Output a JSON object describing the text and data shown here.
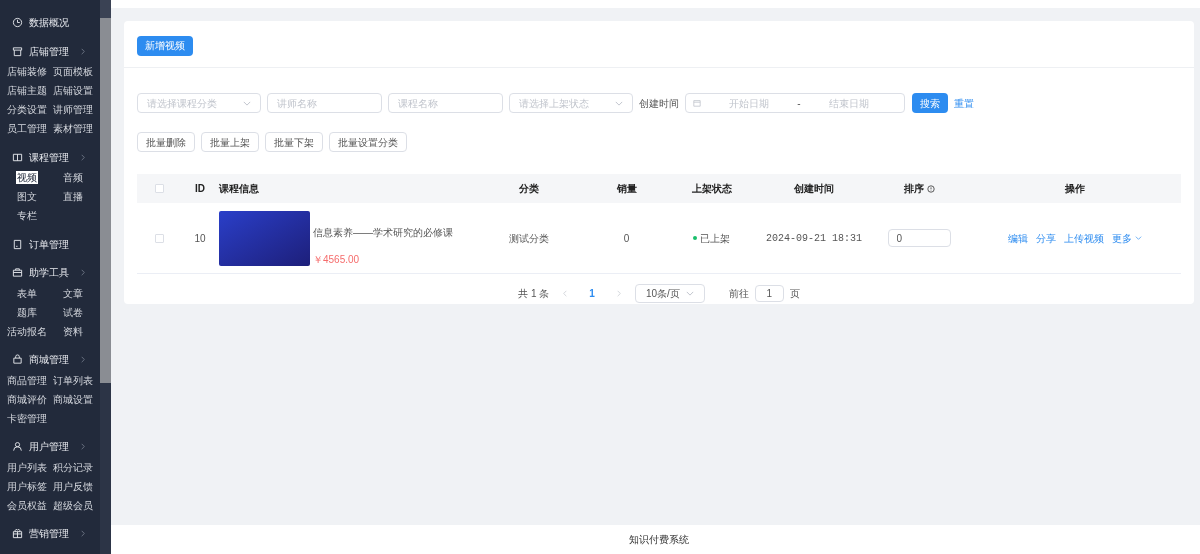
{
  "sidebar": {
    "groups": [
      {
        "title": "数据概况",
        "chevron": false
      },
      {
        "title": "店铺管理",
        "chevron": true,
        "items": [
          {
            "label": "店铺装修",
            "selected": false
          },
          {
            "label": "页面模板",
            "selected": false
          },
          {
            "label": "店铺主题",
            "selected": false
          },
          {
            "label": "店铺设置",
            "selected": false
          },
          {
            "label": "分类设置",
            "selected": false
          },
          {
            "label": "讲师管理",
            "selected": false
          },
          {
            "label": "员工管理",
            "selected": false
          },
          {
            "label": "素材管理",
            "selected": false
          }
        ]
      },
      {
        "title": "课程管理",
        "chevron": true,
        "items": [
          {
            "label": "视频",
            "selected": true
          },
          {
            "label": "音频",
            "selected": false
          },
          {
            "label": "图文",
            "selected": false
          },
          {
            "label": "直播",
            "selected": false
          },
          {
            "label": "专栏",
            "selected": false
          }
        ]
      },
      {
        "title": "订单管理",
        "chevron": false
      },
      {
        "title": "助学工具",
        "chevron": true,
        "items": [
          {
            "label": "表单",
            "selected": false
          },
          {
            "label": "文章",
            "selected": false
          },
          {
            "label": "题库",
            "selected": false
          },
          {
            "label": "试卷",
            "selected": false
          },
          {
            "label": "活动报名",
            "selected": false
          },
          {
            "label": "资料",
            "selected": false
          }
        ]
      },
      {
        "title": "商城管理",
        "chevron": true,
        "items": [
          {
            "label": "商品管理",
            "selected": false
          },
          {
            "label": "订单列表",
            "selected": false
          },
          {
            "label": "商城评价",
            "selected": false
          },
          {
            "label": "商城设置",
            "selected": false
          },
          {
            "label": "卡密管理",
            "selected": false
          }
        ]
      },
      {
        "title": "用户管理",
        "chevron": true,
        "items": [
          {
            "label": "用户列表",
            "selected": false
          },
          {
            "label": "积分记录",
            "selected": false
          },
          {
            "label": "用户标签",
            "selected": false
          },
          {
            "label": "用户反馈",
            "selected": false
          },
          {
            "label": "会员权益",
            "selected": false
          },
          {
            "label": "超级会员",
            "selected": false
          }
        ]
      },
      {
        "title": "营销管理",
        "chevron": true
      }
    ]
  },
  "add_button": "新增视频",
  "filters": {
    "category": {
      "placeholder": "请选择课程分类"
    },
    "teacher": {
      "placeholder": "讲师名称"
    },
    "course": {
      "placeholder": "课程名称"
    },
    "status": {
      "placeholder": "请选择上架状态"
    },
    "date_label": "创建时间",
    "start": {
      "placeholder": "开始日期"
    },
    "separator": "-",
    "end": {
      "placeholder": "结束日期"
    },
    "search": "搜索",
    "reset": "重置"
  },
  "batch_buttons": [
    "批量删除",
    "批量上架",
    "批量下架",
    "批量设置分类"
  ],
  "table": {
    "all_checked": false,
    "columns": [
      "ID",
      "课程信息",
      "分类",
      "销量",
      "上架状态",
      "创建时间",
      "排序",
      "操作"
    ],
    "rows": [
      {
        "checked": false,
        "id": "10",
        "title": "信息素养——学术研究的必修课",
        "price": "￥4565.00",
        "category": "测试分类",
        "sales": "0",
        "status": "已上架",
        "published": true,
        "created": "2024-09-21 18:31",
        "sort": "0",
        "actions": [
          "编辑",
          "分享",
          "上传视频",
          "更多"
        ]
      }
    ]
  },
  "pagination": {
    "total": "共 1 条",
    "pages": [
      {
        "label": "1",
        "selected": true
      }
    ],
    "page_size": "10条/页",
    "goto_label": "前往",
    "goto_value": "1",
    "goto_suffix": "页"
  },
  "footer": "知识付费系统"
}
